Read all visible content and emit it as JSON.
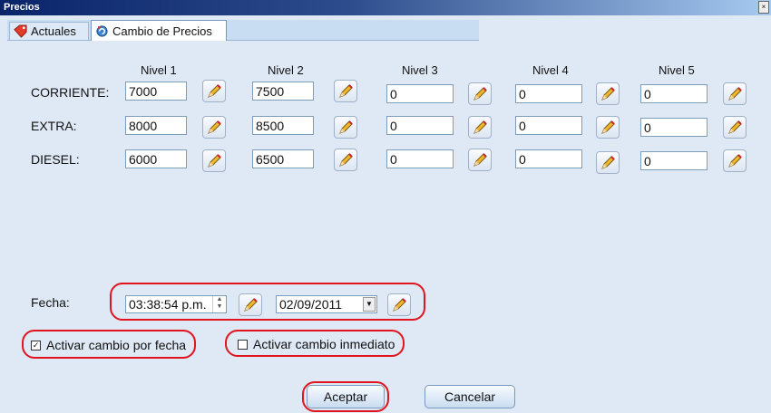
{
  "window": {
    "title": "Precios"
  },
  "tabs": [
    {
      "label": "Actuales",
      "icon": "price-tag-icon"
    },
    {
      "label": "Cambio de Precios",
      "icon": "refresh-icon"
    }
  ],
  "levels": [
    "Nivel 1",
    "Nivel 2",
    "Nivel 3",
    "Nivel 4",
    "Nivel 5"
  ],
  "rows": [
    {
      "label": "CORRIENTE:",
      "values": [
        "7000",
        "7500",
        "0",
        "0",
        "0"
      ]
    },
    {
      "label": "EXTRA:",
      "values": [
        "8000",
        "8500",
        "0",
        "0",
        "0"
      ]
    },
    {
      "label": "DIESEL:",
      "values": [
        "6000",
        "6500",
        "0",
        "0",
        "0"
      ]
    }
  ],
  "fecha": {
    "label": "Fecha:",
    "time": "03:38:54 p.m.",
    "date": "02/09/2011"
  },
  "options": {
    "activar_fecha": "Activar cambio por fecha",
    "activar_inmediato": "Activar cambio inmediato",
    "activar_fecha_checked": true,
    "activar_inmediato_checked": false
  },
  "buttons": {
    "accept": "Aceptar",
    "cancel": "Cancelar"
  },
  "colors": {
    "highlight": "#e0141e",
    "panel": "#dfe9f5"
  }
}
